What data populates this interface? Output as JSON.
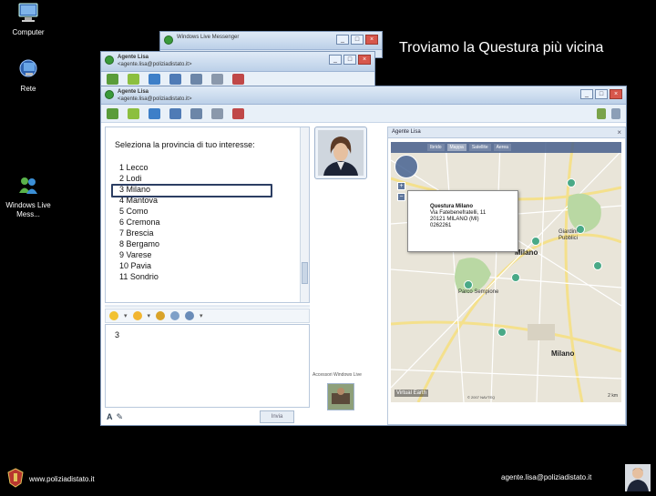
{
  "slide": {
    "title": "Troviamo la Questura più vicina"
  },
  "desktop_icons": [
    {
      "label": "Computer",
      "icon": "computer-icon"
    },
    {
      "label": "Rete",
      "icon": "network-icon"
    },
    {
      "label": "Windows Live Mess...",
      "icon": "messenger-icon"
    }
  ],
  "back_window_1": {
    "title": "Windows Live Messenger"
  },
  "back_window_2": {
    "title": "Agente Lisa",
    "subtitle": "<agente.lisa@poliziadistato.it>"
  },
  "main_window": {
    "title": "Agente Lisa",
    "subtitle": "<agente.lisa@poliziadistato.it>",
    "prompt": "Seleziona la provincia di tuo interesse:",
    "provinces": [
      "1 Lecco",
      "2 Lodi",
      "3 Milano",
      "4 Mantova",
      "5 Como",
      "6 Cremona",
      "7 Brescia",
      "8 Bergamo",
      "9 Varese",
      "10 Pavia",
      "11 Sondrio"
    ],
    "selected_index": 2,
    "typed_text": "3",
    "send_label": "Invia",
    "accessori_label": "Accessori Windows Live"
  },
  "map": {
    "header": "Agente Lisa",
    "tabs": [
      "Ibrido",
      "Mappa",
      "Satellite",
      "Aerea"
    ],
    "info_title": "Questura Milano",
    "info_lines": [
      "Via Fatebenefratelli, 11",
      "20121 MILANO (MI)",
      "0262261"
    ],
    "labels": [
      "Milano",
      "Giardini Pubblici",
      "Parco Sempione",
      "Milano"
    ],
    "logo": "Virtual Earth",
    "scale": "2 km",
    "copyright": "© 2007 NAVTEQ"
  },
  "footer": {
    "left": "www.poliziadistato.it",
    "right": "agente.lisa@poliziadistato.it"
  }
}
